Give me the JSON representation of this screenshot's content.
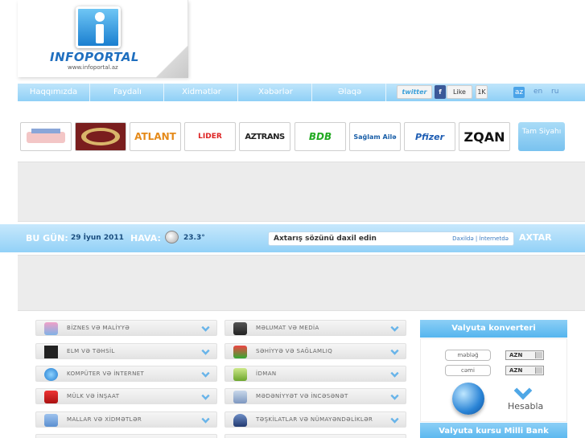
{
  "header": {
    "logo_text": "INFOPORTAL",
    "logo_url": "www.infoportal.az"
  },
  "nav": {
    "items": [
      "Haqqımızda",
      "Faydalı",
      "Xidmətlər",
      "Xəbərlər",
      "Əlaqə"
    ]
  },
  "social": {
    "twitter": "twitter",
    "facebook": "f",
    "like": "Like",
    "like_count": "1K"
  },
  "languages": [
    "az",
    "en",
    "ru"
  ],
  "sponsors": [
    "",
    "",
    "ATLANT",
    "LIDER",
    "AZTRANS",
    "BDB",
    "Sağlam Ailə",
    "Pfizer",
    "ZQAN"
  ],
  "all_list": "Tam Siyahı",
  "infobar": {
    "today_label": "BU GÜN:",
    "today_value": "29 İyun 2011",
    "weather_label": "HAVA:",
    "weather_value": "23.3°",
    "search_placeholder": "Axtarış sözünü daxil edin",
    "search_options": "Daxildə | İnternetdə",
    "search_button": "AXTAR"
  },
  "categories_left": [
    "BİZNES VƏ MALİYYƏ",
    "ELM VƏ TƏHSİL",
    "KOMPÜTER VƏ İNTERNET",
    "MÜLK VƏ İNŞAAT",
    "MALLAR VƏ XİDMƏTLƏR"
  ],
  "categories_right": [
    "MƏLUMAT VƏ MEDİA",
    "SƏHİYYƏ VƏ SAĞLAMLIQ",
    "İDMAN",
    "MƏDƏNİYYƏT VƏ İNCƏSƏNƏT",
    "TƏŞKİLATLAR VƏ NÜMAYƏNDƏLİKLƏR"
  ],
  "converter": {
    "title": "Valyuta konverteri",
    "amount_label": "məbləğ",
    "sum_label": "cəmi",
    "currency1": "AZN",
    "currency2": "AZN",
    "calc_button": "Hesabla"
  },
  "rates": {
    "title": "Valyuta kursu Milli Bank"
  },
  "colors": {
    "accent": "#8fd0f6",
    "text_dark": "#1a4d7e"
  }
}
